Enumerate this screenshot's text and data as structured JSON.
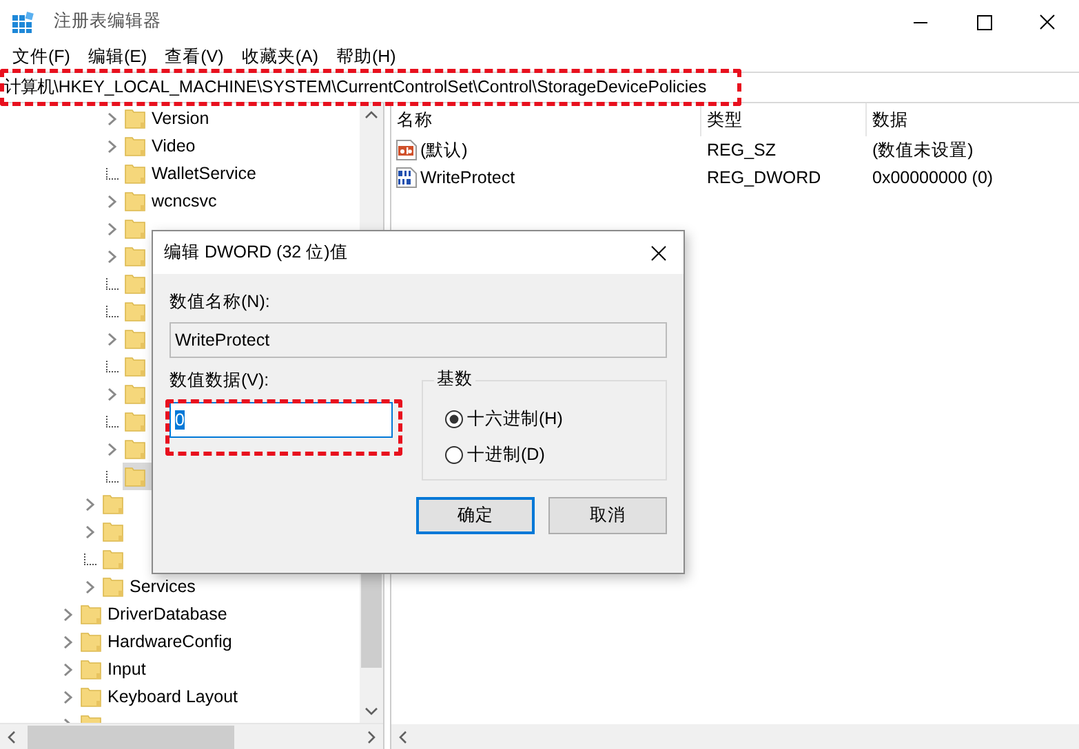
{
  "window": {
    "title": "注册表编辑器"
  },
  "menu": [
    "文件(F)",
    "编辑(E)",
    "查看(V)",
    "收藏夹(A)",
    "帮助(H)"
  ],
  "address_bar": {
    "path": "计算机\\HKEY_LOCAL_MACHINE\\SYSTEM\\CurrentControlSet\\Control\\StorageDevicePolicies",
    "highlight": true
  },
  "tree": [
    {
      "children": [
        {
          "children": [
            {
              "label": "Version",
              "expandable": true,
              "selected": false
            },
            {
              "label": "Video",
              "expandable": true,
              "selected": false
            },
            {
              "label": "WalletService",
              "expandable": false,
              "selected": false
            },
            {
              "label": "wcncsvc",
              "expandable": true,
              "selected": false
            },
            {
              "expandable": true,
              "selected": false
            },
            {
              "expandable": true,
              "selected": false
            },
            {
              "expandable": false,
              "selected": false
            },
            {
              "expandable": false,
              "selected": false
            },
            {
              "expandable": true,
              "selected": false
            },
            {
              "expandable": false,
              "selected": false
            },
            {
              "expandable": true,
              "selected": false
            },
            {
              "expandable": false,
              "selected": false
            },
            {
              "expandable": true,
              "selected": false
            },
            {
              "expandable": false,
              "selected": true
            }
          ]
        },
        {
          "expandable": true,
          "selected": false
        },
        {
          "expandable": true,
          "selected": false
        },
        {
          "expandable": false,
          "selected": false
        },
        {
          "label": "Services",
          "expandable": true,
          "selected": false
        }
      ]
    },
    {
      "label": "DriverDatabase",
      "expandable": true,
      "selected": false
    },
    {
      "label": "HardwareConfig",
      "expandable": true,
      "selected": false
    },
    {
      "label": "Input",
      "expandable": true,
      "selected": false
    },
    {
      "label": "Keyboard Layout",
      "expandable": true,
      "selected": false
    },
    {
      "expandable": true,
      "selected": false
    }
  ],
  "values_table": {
    "columns": [
      "名称",
      "类型",
      "数据"
    ],
    "rows": [
      {
        "kind": "string",
        "name": "(默认)",
        "type": "REG_SZ",
        "data": "(数值未设置)"
      },
      {
        "kind": "binary",
        "name": "WriteProtect",
        "type": "REG_DWORD",
        "data": "0x00000000 (0)"
      }
    ]
  },
  "dialog": {
    "title": "编辑 DWORD (32 位)值",
    "name_label": "数值名称(N):",
    "name_value": "WriteProtect",
    "data_label": "数值数据(V):",
    "data_value": "0",
    "data_highlight": true,
    "base_label": "基数",
    "bases": [
      {
        "label": "十六进制(H)",
        "selected": true
      },
      {
        "label": "十进制(D)",
        "selected": false
      }
    ],
    "buttons": [
      {
        "label": "确定",
        "default": true
      },
      {
        "label": "取消",
        "default": false
      }
    ]
  }
}
